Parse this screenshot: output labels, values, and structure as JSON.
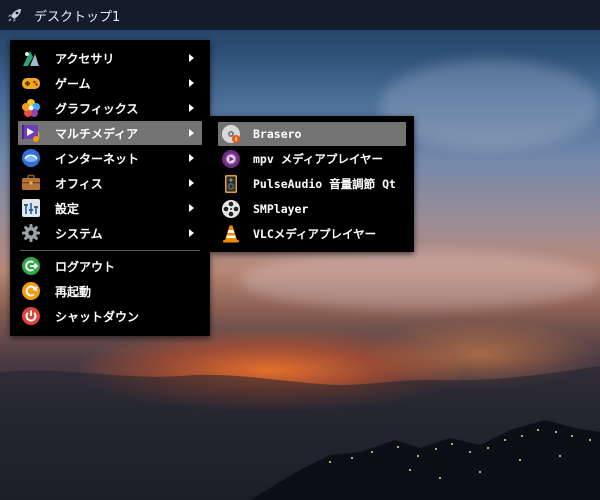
{
  "taskbar": {
    "title": "デスクトップ1",
    "launcher_icon": "rocket-icon"
  },
  "main_menu": {
    "categories": [
      {
        "label": "アクセサリ",
        "icon": "accessories-icon",
        "has_submenu": true
      },
      {
        "label": "ゲーム",
        "icon": "gamepad-icon",
        "has_submenu": true
      },
      {
        "label": "グラフィックス",
        "icon": "graphics-icon",
        "has_submenu": true
      },
      {
        "label": "マルチメディア",
        "icon": "multimedia-icon",
        "has_submenu": true,
        "highlighted": true
      },
      {
        "label": "インターネット",
        "icon": "internet-icon",
        "has_submenu": true
      },
      {
        "label": "オフィス",
        "icon": "briefcase-icon",
        "has_submenu": true
      },
      {
        "label": "設定",
        "icon": "settings-icon",
        "has_submenu": true
      },
      {
        "label": "システム",
        "icon": "gear-icon",
        "has_submenu": true
      }
    ],
    "session": [
      {
        "label": "ログアウト",
        "icon": "logout-icon"
      },
      {
        "label": "再起動",
        "icon": "restart-icon"
      },
      {
        "label": "シャットダウン",
        "icon": "power-icon"
      }
    ]
  },
  "submenu": {
    "items": [
      {
        "label": "Brasero",
        "icon": "disc-burner-icon",
        "highlighted": true
      },
      {
        "label": "mpv メディアプレイヤー",
        "icon": "mpv-icon"
      },
      {
        "label": "PulseAudio 音量調節 Qt",
        "icon": "speaker-icon"
      },
      {
        "label": "SMPlayer",
        "icon": "film-reel-icon"
      },
      {
        "label": "VLCメディアプレイヤー",
        "icon": "vlc-cone-icon"
      }
    ]
  },
  "colors": {
    "menu_background": "#000000",
    "highlight": "#737373",
    "taskbar": "#131c2b"
  }
}
